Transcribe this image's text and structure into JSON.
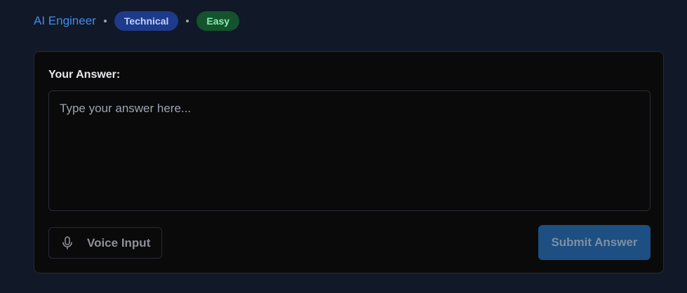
{
  "question_meta": {
    "role": "AI Engineer",
    "category": "Technical",
    "difficulty": "Easy"
  },
  "answer": {
    "label": "Your Answer:",
    "value": "",
    "placeholder": "Type your answer here..."
  },
  "actions": {
    "voice_input_label": "Voice Input",
    "voice_icon": "microphone-icon",
    "submit_label": "Submit Answer"
  },
  "colors": {
    "background": "#111827",
    "card": "#0a0a0b",
    "role_link": "#3b8ff0",
    "badge_technical_bg": "#1e3a8a",
    "badge_easy_bg": "#14532d",
    "submit_bg": "#1d4f82"
  }
}
